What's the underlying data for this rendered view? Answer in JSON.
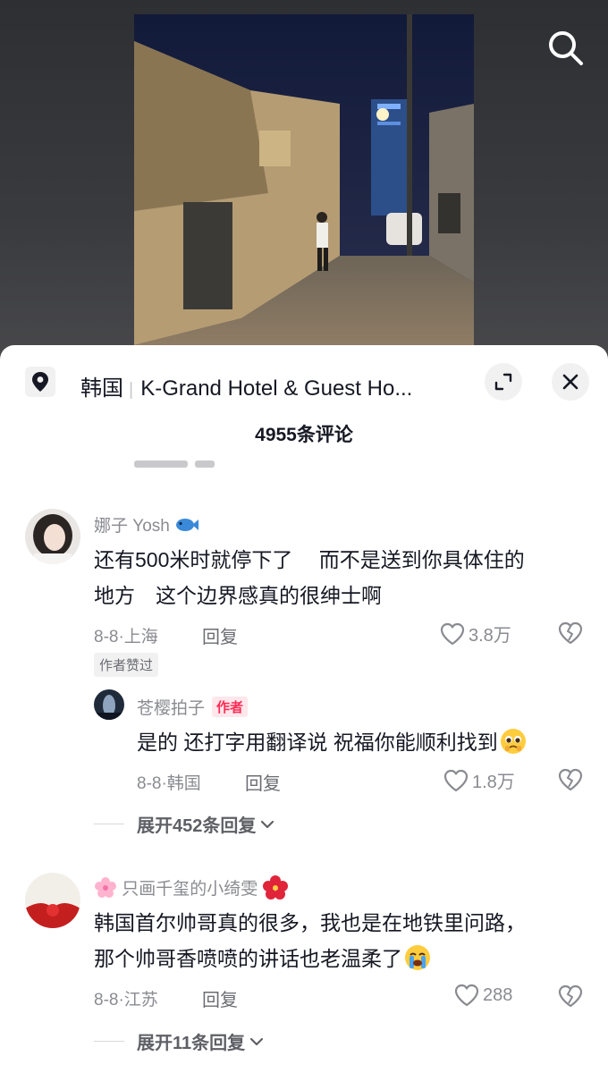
{
  "header": {
    "search_icon": "search-icon"
  },
  "sheet": {
    "location_prefix": "韩国",
    "location_name": "K-Grand Hotel & Guest Ho...",
    "comment_count_title": "4955条评论"
  },
  "comments": [
    {
      "username": "娜子 Yosh",
      "username_emoji": "fish-emoji",
      "text_line1": "还有500米时就停下了　 而不是送到你具体住的",
      "text_line2": "地方　这个边界感真的很绅士啊",
      "meta": "8-8·上海",
      "reply_label": "回复",
      "likes": "3.8万",
      "badge": "作者赞过",
      "replies": [
        {
          "username": "苍樱拍子",
          "author_tag": "作者",
          "text": "是的 还打字用翻译说 祝福你能顺利找到",
          "text_emoji": "pleading-face-emoji",
          "meta": "8-8·韩国",
          "reply_label": "回复",
          "likes": "1.8万"
        }
      ],
      "expand_label": "展开452条回复"
    },
    {
      "username": "只画千玺的小绮雯",
      "username_prefix_emoji": "cherry-blossom-emoji",
      "username_suffix_emoji": "hibiscus-emoji",
      "text_line1": "韩国首尔帅哥真的很多，我也是在地铁里问路，",
      "text_line2": "那个帅哥香喷喷的讲话也老温柔了",
      "text_emoji": "crying-face-emoji",
      "meta": "8-8·江苏",
      "reply_label": "回复",
      "likes": "288",
      "expand_label": "展开11条回复"
    }
  ],
  "colors": {
    "accent": "#fe2c55",
    "text_primary": "#161823",
    "text_secondary": "#8a8b91"
  }
}
